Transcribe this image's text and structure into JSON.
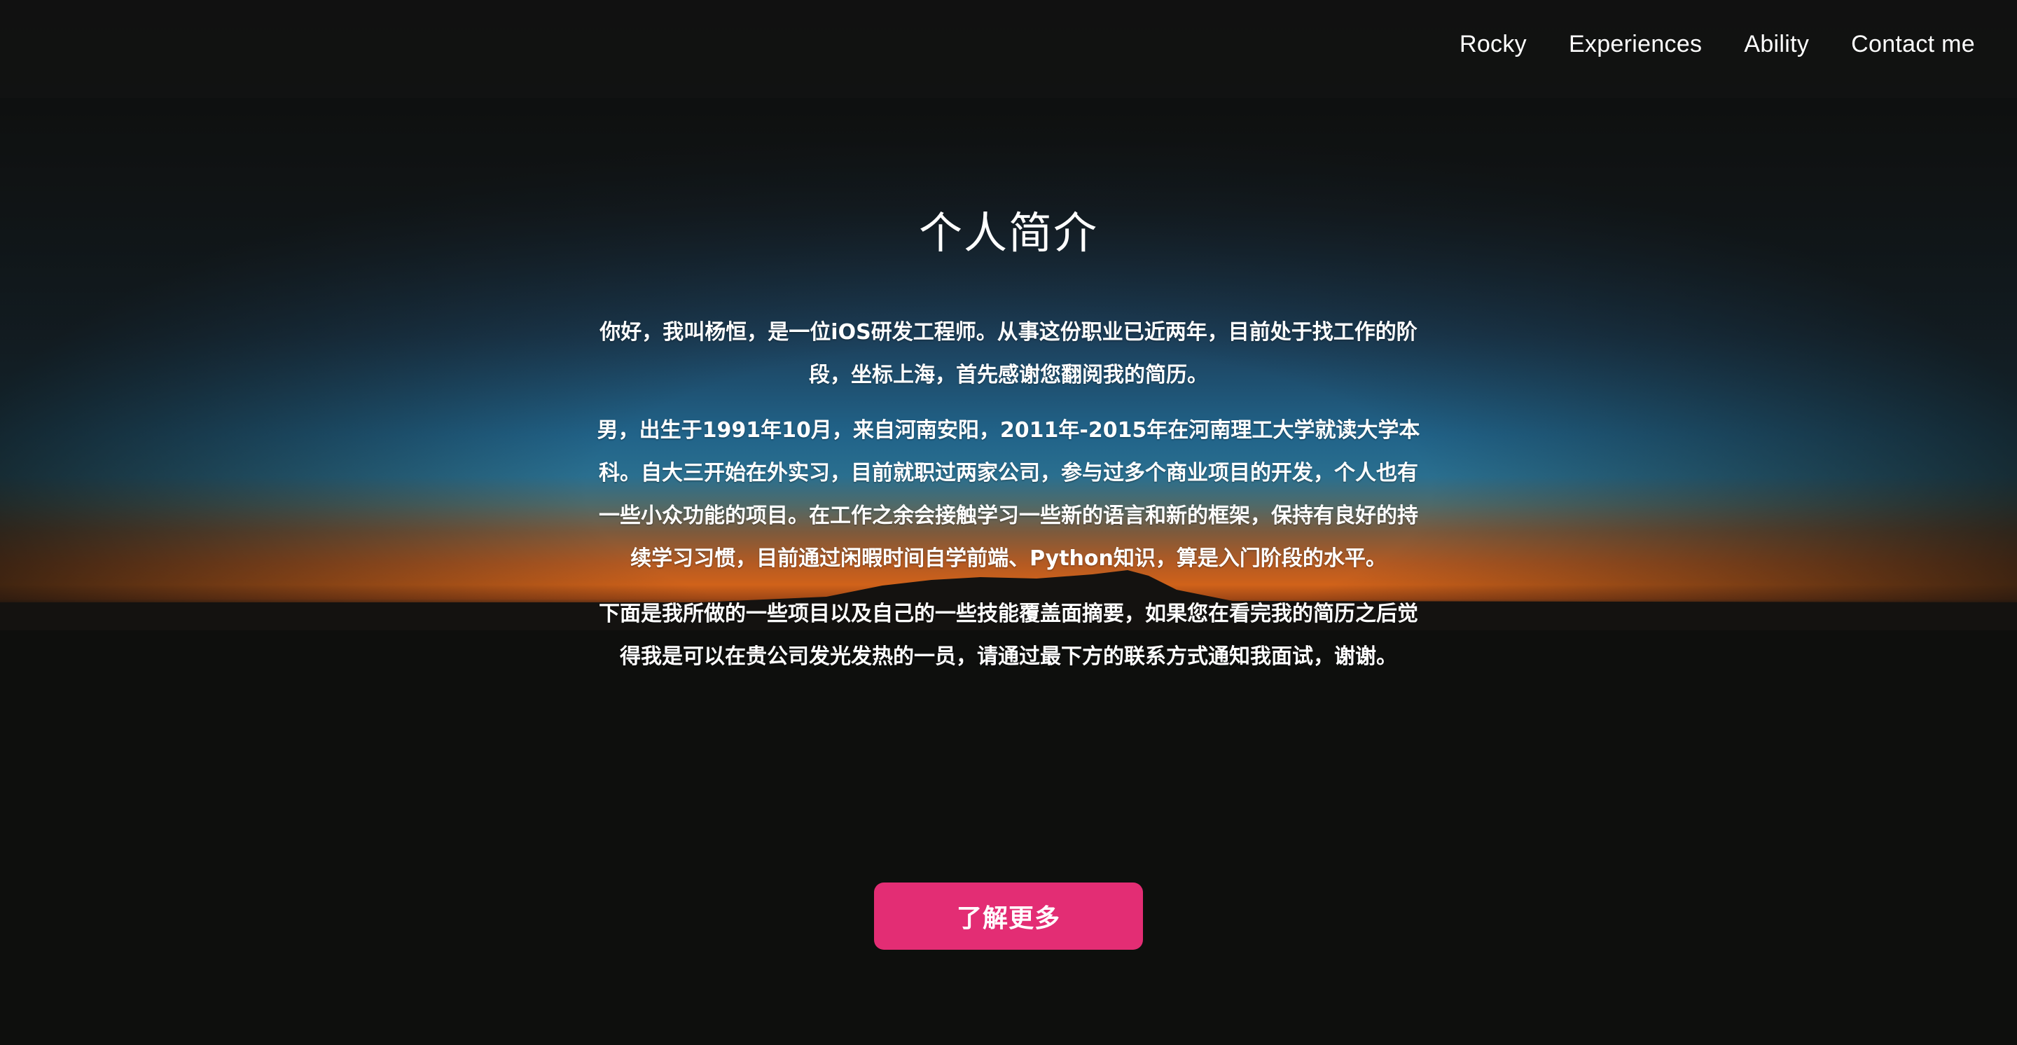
{
  "nav": {
    "items": [
      {
        "label": "Rocky"
      },
      {
        "label": "Experiences"
      },
      {
        "label": "Ability"
      },
      {
        "label": "Contact me"
      }
    ]
  },
  "intro": {
    "title": "个人简介",
    "paragraphs": [
      "你好，我叫杨恒，是一位iOS研发工程师。从事这份职业已近两年，目前处于找工作的阶段，坐标上海，首先感谢您翻阅我的简历。",
      "男，出生于1991年10月，来自河南安阳，2011年-2015年在河南理工大学就读大学本科。自大三开始在外实习，目前就职过两家公司，参与过多个商业项目的开发，个人也有一些小众功能的项目。在工作之余会接触学习一些新的语言和新的框架，保持有良好的持续学习习惯，目前通过闲暇时间自学前端、Python知识，算是入门阶段的水平。",
      "下面是我所做的一些项目以及自己的一些技能覆盖面摘要，如果您在看完我的简历之后觉得我是可以在贵公司发光发热的一员，请通过最下方的联系方式通知我面试，谢谢。"
    ],
    "cta_label": "了解更多"
  },
  "colors": {
    "accent": "#e32d74",
    "background": "#0e0f0d",
    "text": "#ffffff"
  }
}
